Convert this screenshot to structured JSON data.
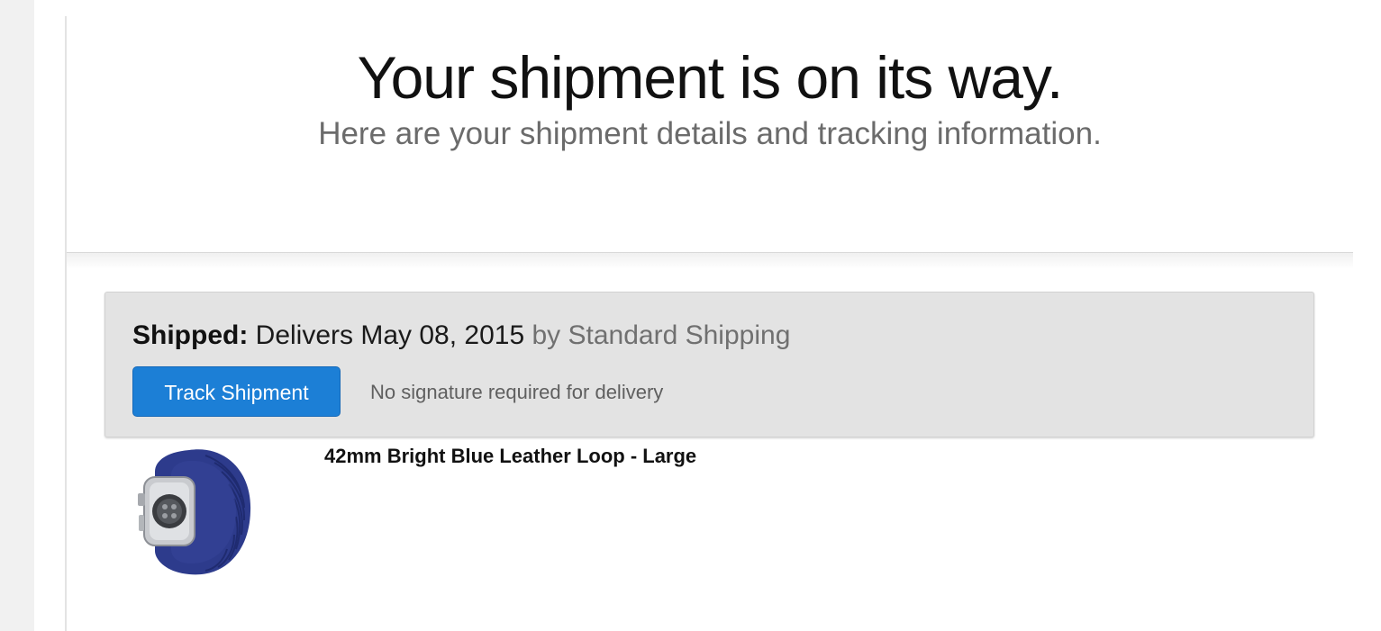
{
  "hero": {
    "title": "Your shipment is on its way.",
    "subtitle": "Here are your shipment details and tracking information."
  },
  "shipment": {
    "status_label": "Shipped:",
    "delivery_text": "Delivers May 08, 2015",
    "method_text": "by Standard Shipping",
    "track_button_label": "Track Shipment",
    "signature_note": "No signature required for delivery"
  },
  "product": {
    "name": "42mm Bright Blue Leather Loop - Large",
    "image_icon": "watch-image"
  },
  "colors": {
    "button_blue": "#1c7fd6",
    "panel_gray": "#e3e3e3",
    "band_blue": "#2d3b8c"
  }
}
